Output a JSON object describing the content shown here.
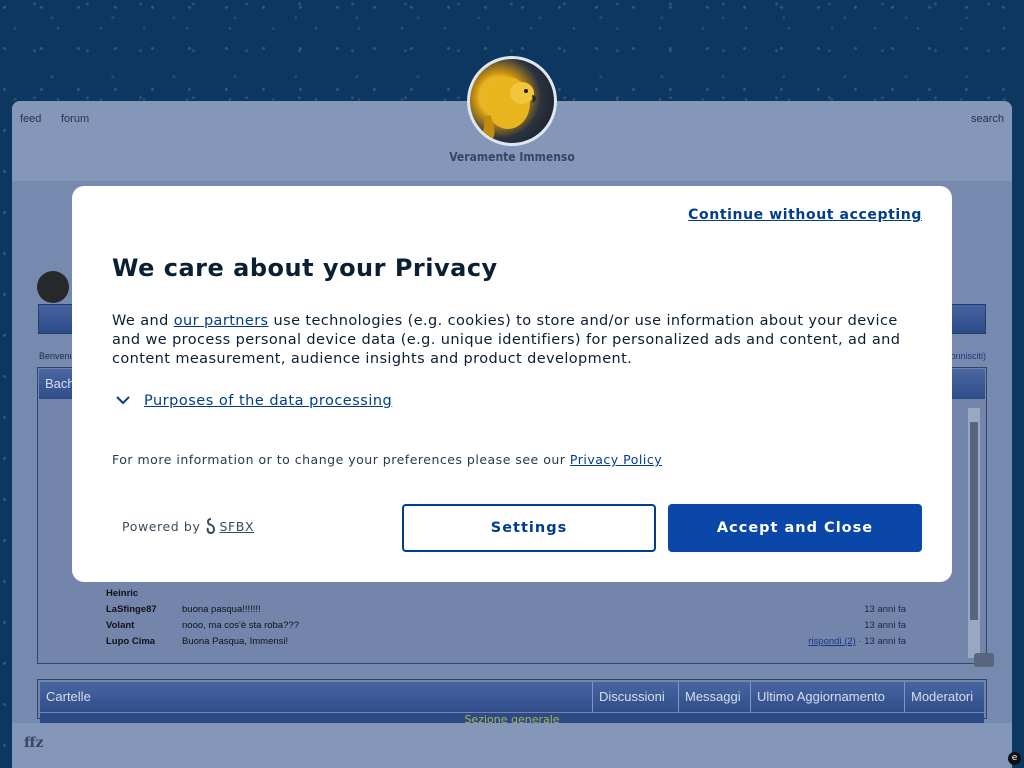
{
  "site": {
    "title": "Veramente Immenso",
    "nav_left": [
      "feed",
      "forum"
    ],
    "nav_right": "search",
    "footer_logo": "ffz"
  },
  "forum": {
    "welcome_text": "Benvenu",
    "logout_text": "sconnisciti)",
    "shoutbox_title": "Bach",
    "shout_rows": [
      {
        "user": "Heinric",
        "message": "",
        "reply": "",
        "time": ""
      },
      {
        "user": "LaSfinge87",
        "message": "buona pasqua!!!!!!!",
        "reply": "",
        "time": "13 anni fa"
      },
      {
        "user": "Volant",
        "message": "nooo, ma cos'è sta roba???",
        "reply": "",
        "time": "13 anni fa"
      },
      {
        "user": "Lupo Cima",
        "message": "Buona Pasqua, Immensi!",
        "reply": "rispondi (2)",
        "time": "· 13 anni fa"
      }
    ],
    "category_columns": [
      "Cartelle",
      "Discussioni",
      "Messaggi",
      "Ultimo Aggiornamento",
      "Moderatori"
    ],
    "category_section": "Sezione generale"
  },
  "consent": {
    "continue_label": "Continue without accepting",
    "title": "We care about your Privacy",
    "body_prefix": "We and ",
    "partners_link": "our partners",
    "body_suffix": " use technologies (e.g. cookies) to store and/or use information about your device and we process personal device data (e.g. unique identifiers) for personalized ads and content, ad and content measurement, audience insights and product development.",
    "purposes_label": "Purposes of the data processing",
    "more_info_text": "For more information or to change your preferences please see our ",
    "privacy_policy_link": "Privacy Policy",
    "powered_by": "Powered by",
    "brand": "SFBX",
    "settings_button": "Settings",
    "accept_button": "Accept and Close"
  },
  "colors": {
    "accent": "#0a47a8",
    "link": "#003d8f",
    "page_background": "#0c3a64"
  },
  "icons": {
    "chevron": "chevron-down-icon",
    "brand_logo": "sfbx-logo-icon",
    "corner": "e-badge-icon"
  }
}
